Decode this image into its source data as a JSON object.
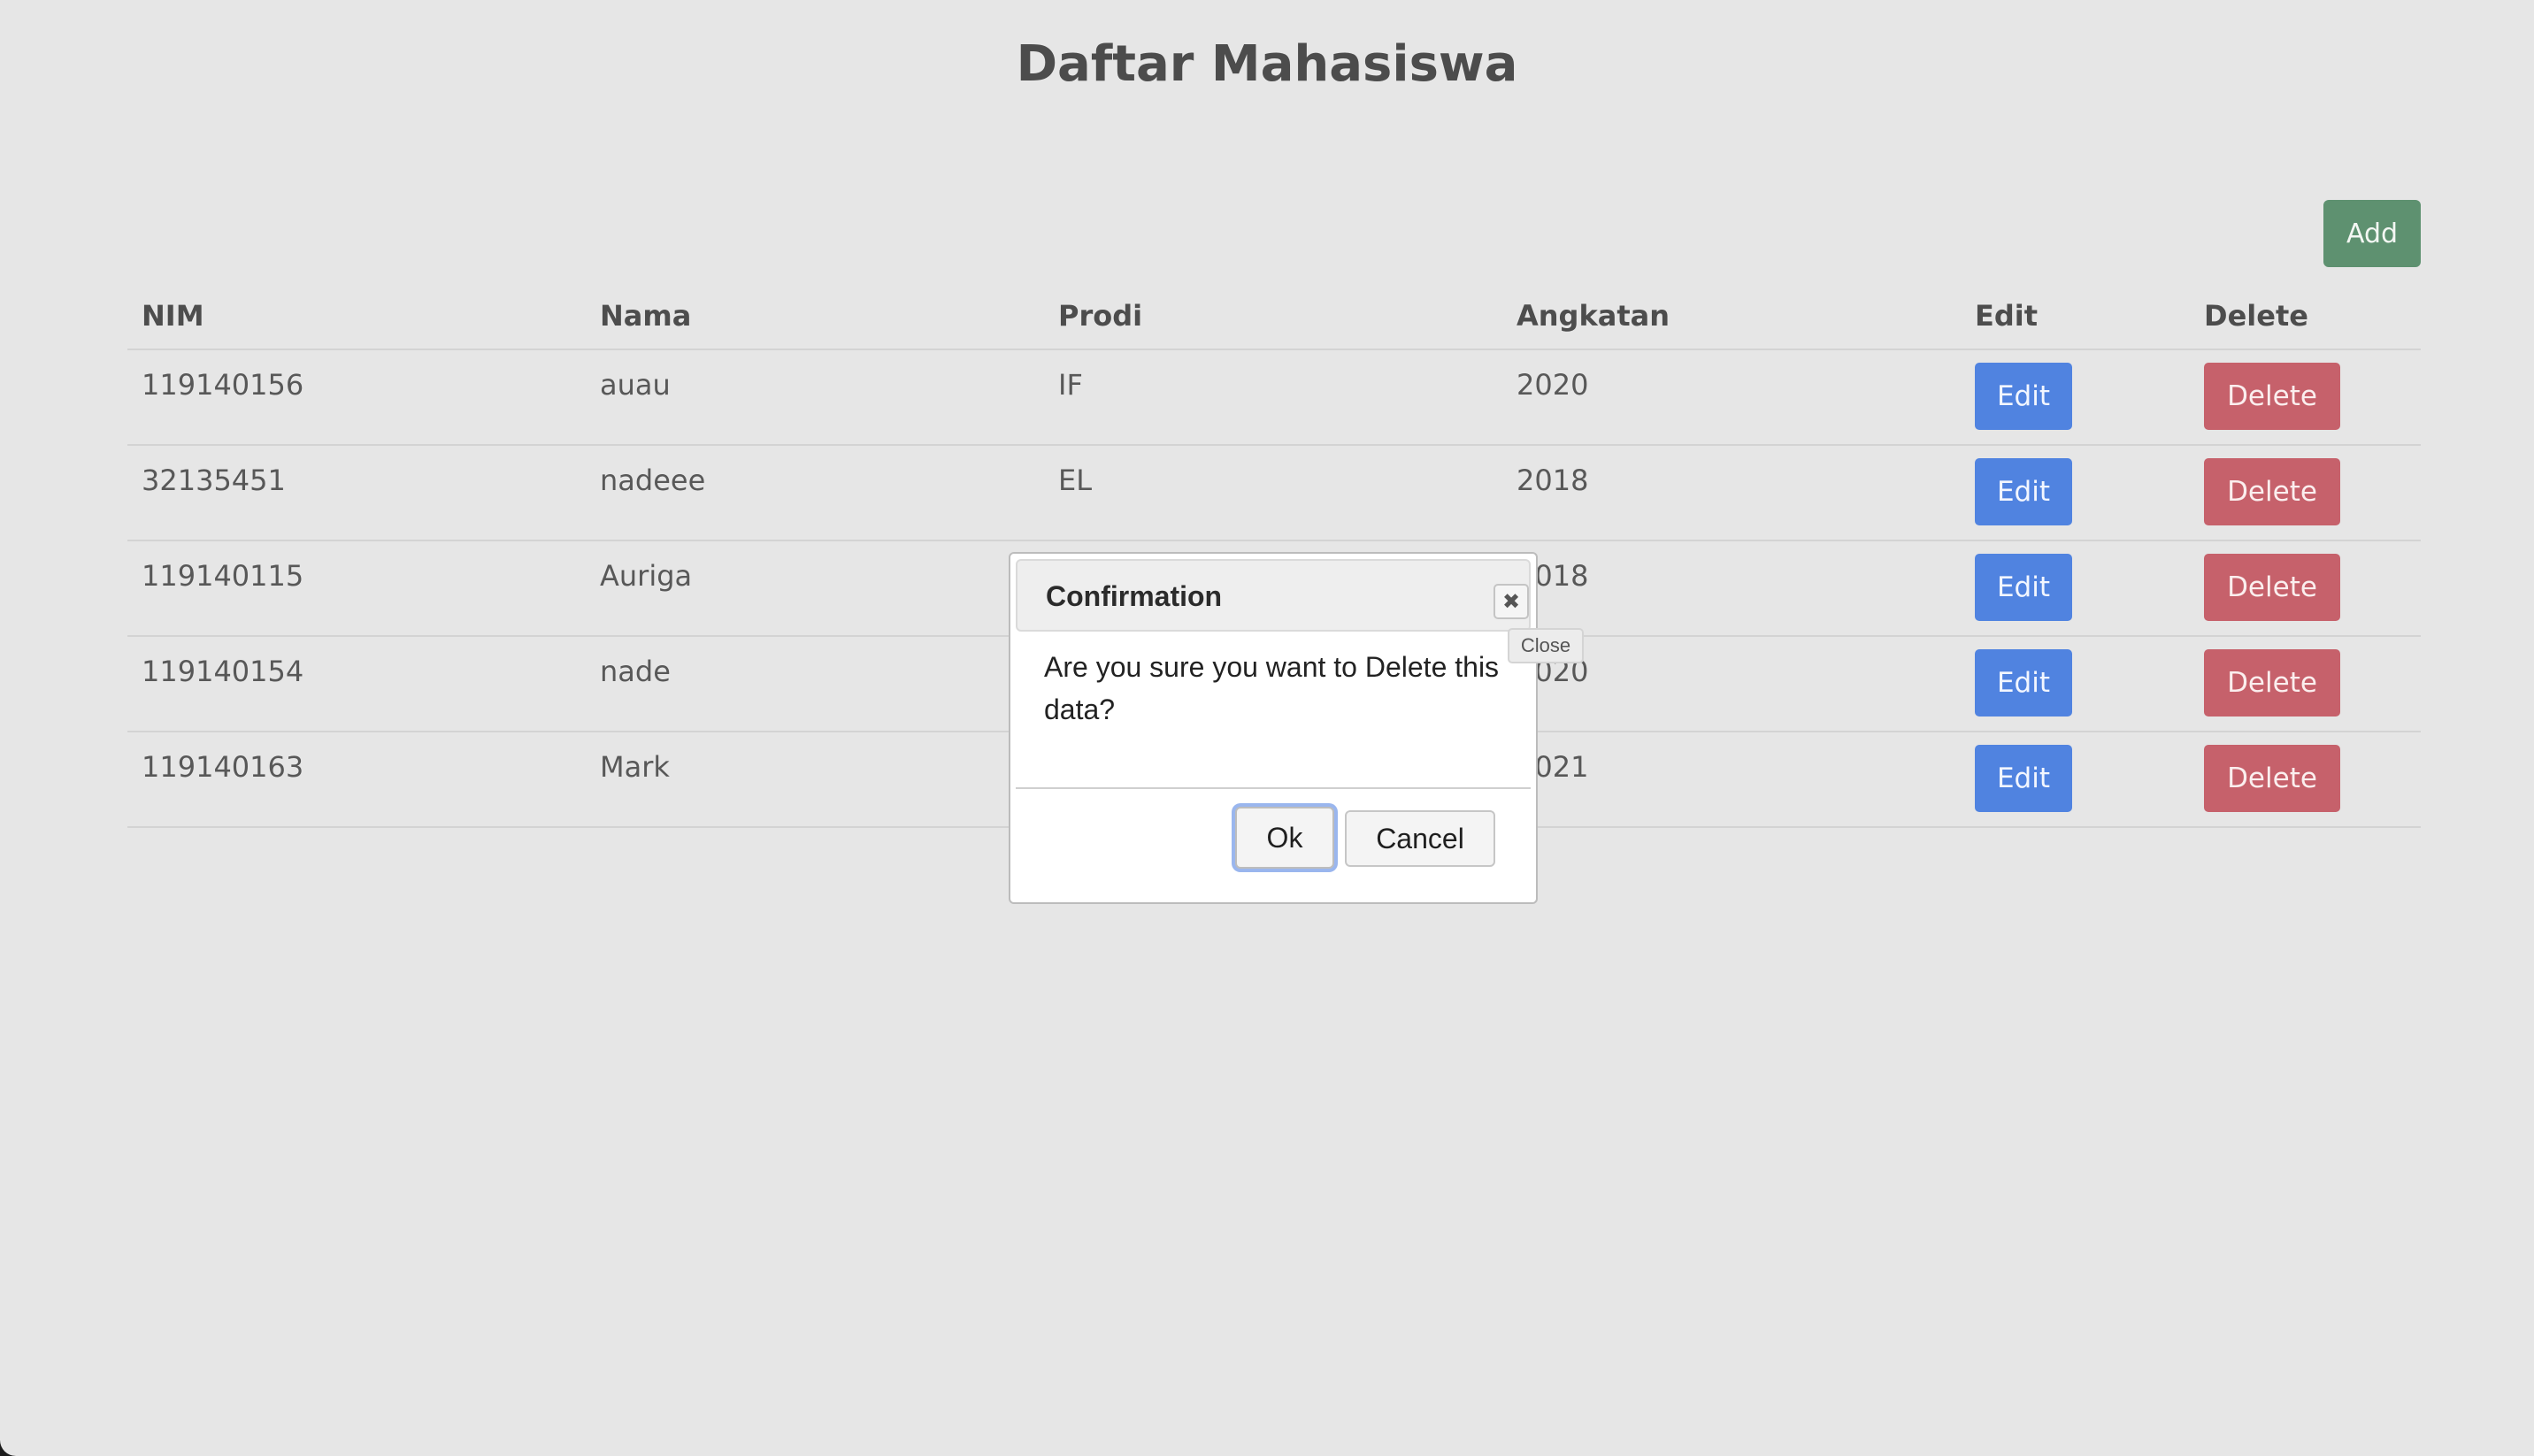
{
  "page": {
    "title": "Daftar Mahasiswa",
    "add_label": "Add"
  },
  "table": {
    "headers": [
      "NIM",
      "Nama",
      "Prodi",
      "Angkatan",
      "Edit",
      "Delete"
    ],
    "edit_label": "Edit",
    "delete_label": "Delete",
    "rows": [
      {
        "nim": "119140156",
        "nama": "auau",
        "prodi": "IF",
        "angkatan": "2020"
      },
      {
        "nim": "32135451",
        "nama": "nadeee",
        "prodi": "EL",
        "angkatan": "2018"
      },
      {
        "nim": "119140115",
        "nama": "Auriga",
        "prodi": "",
        "angkatan": "2018"
      },
      {
        "nim": "119140154",
        "nama": "nade",
        "prodi": "",
        "angkatan": "2020"
      },
      {
        "nim": "119140163",
        "nama": "Mark",
        "prodi": "",
        "angkatan": "2021"
      }
    ]
  },
  "dialog": {
    "title": "Confirmation",
    "close_glyph": "✖",
    "close_tooltip": "Close",
    "message": "Are you sure you want to Delete this data?",
    "ok_label": "Ok",
    "cancel_label": "Cancel"
  },
  "colors": {
    "background": "#e6e6e6",
    "add_button": "#5e9170",
    "edit_button": "#5083e0",
    "delete_button": "#c6616b"
  }
}
